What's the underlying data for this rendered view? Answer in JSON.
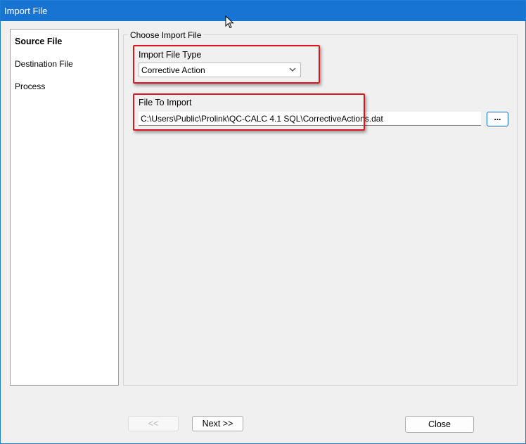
{
  "window": {
    "title": "Import File"
  },
  "steps": [
    {
      "label": "Source File",
      "active": true
    },
    {
      "label": "Destination File",
      "active": false
    },
    {
      "label": "Process",
      "active": false
    }
  ],
  "group": {
    "legend": "Choose Import File"
  },
  "import_type": {
    "label": "Import File Type",
    "selected": "Corrective Action"
  },
  "file_to_import": {
    "label": "File To Import",
    "value": "C:\\Users\\Public\\Prolink\\QC-CALC 4.1 SQL\\CorrectiveActions.dat",
    "browse_label": "..."
  },
  "buttons": {
    "back": "<<",
    "next": "Next >>",
    "close": "Close"
  },
  "colors": {
    "title_bar": "#1874d2",
    "highlight_box": "#e0141e",
    "focus_border": "#0a64c8"
  },
  "icons": {
    "dropdown": "chevron-down-icon",
    "cursor": "mouse-pointer-icon"
  }
}
